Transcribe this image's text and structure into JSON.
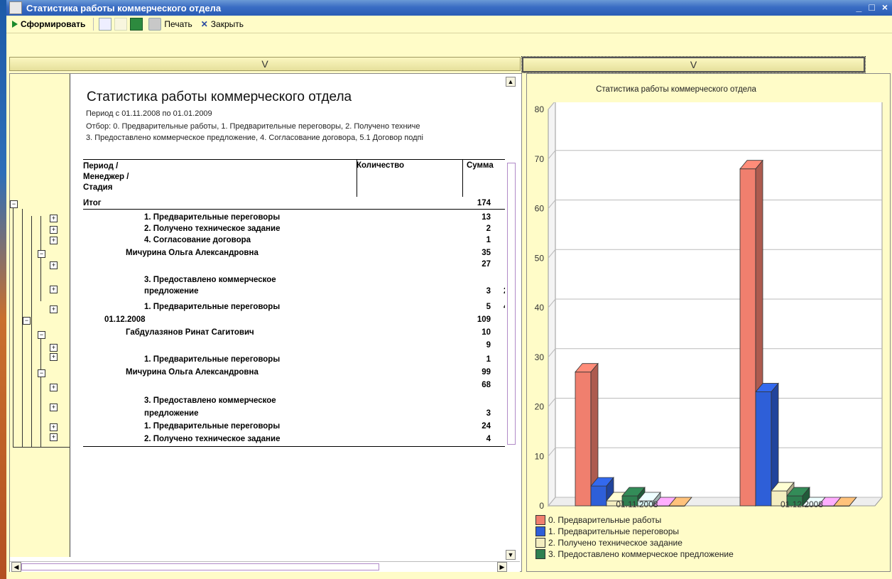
{
  "window": {
    "title": "Статистика работы коммерческого отдела",
    "controls": [
      "_",
      "□",
      "×"
    ]
  },
  "toolbar": {
    "generate_label": "Сформировать",
    "print_label": "Печать",
    "close_label": "Закрыть",
    "icons": [
      "play-icon",
      "expand-all-icon",
      "collapse-all-icon",
      "excel-icon",
      "printer-icon",
      "close-icon"
    ]
  },
  "splitter": {
    "left_glyph": "V",
    "right_glyph": "V"
  },
  "report": {
    "title": "Статистика работы коммерческого отдела",
    "period": "Период с 01.11.2008 по 01.01.2009",
    "filter_line1": "Отбор:  0. Предварительные работы, 1. Предварительные переговоры, 2. Получено техниче",
    "filter_line2": "3. Предоставлено коммерческое предложение, 4. Согласование договора, 5.1 Договор подпі",
    "header": {
      "period": "Период /",
      "manager": "Менеджер /",
      "stage": "Стадия",
      "qty": "Количество",
      "sum": "Сумма"
    },
    "rows": [
      {
        "label": "Итог",
        "value": "174",
        "sum": ""
      },
      {
        "label": "1. Предварительные переговоры",
        "value": "13",
        "sum": ""
      },
      {
        "label": "2. Получено техническое задание",
        "value": "2",
        "sum": ""
      },
      {
        "label": "4. Согласование договора",
        "value": "1",
        "sum": ""
      },
      {
        "label": "Мичурина Ольга Александровна",
        "value": "35",
        "sum": ""
      },
      {
        "label": "",
        "value": "27",
        "sum": ""
      },
      {
        "label": "3. Предоставлено коммерческое",
        "value": "",
        "sum": ""
      },
      {
        "label": "предложение",
        "value": "3",
        "sum": "2"
      },
      {
        "label": "1. Предварительные переговоры",
        "value": "5",
        "sum": "4"
      },
      {
        "label": "01.12.2008",
        "value": "109",
        "sum": ""
      },
      {
        "label": "Габдулазянов Ринат Сагитович",
        "value": "10",
        "sum": ""
      },
      {
        "label": "",
        "value": "9",
        "sum": ""
      },
      {
        "label": "1. Предварительные переговоры",
        "value": "1",
        "sum": ""
      },
      {
        "label": "Мичурина Ольга Александровна",
        "value": "99",
        "sum": ""
      },
      {
        "label": "",
        "value": "68",
        "sum": ""
      },
      {
        "label": "3. Предоставлено коммерческое",
        "value": "",
        "sum": ""
      },
      {
        "label": "предложение",
        "value": "3",
        "sum": ""
      },
      {
        "label": "1. Предварительные переговоры",
        "value": "24",
        "sum": ""
      },
      {
        "label": "2. Получено техническое задание",
        "value": "4",
        "sum": ""
      }
    ]
  },
  "chart_data": {
    "type": "bar",
    "title": "Статистика работы коммерческого отдела",
    "categories": [
      "01.11.2008",
      "01.12.2008"
    ],
    "ylim": [
      0,
      80
    ],
    "yticks": [
      0,
      10,
      20,
      30,
      40,
      50,
      60,
      70,
      80
    ],
    "grid": true,
    "three_d": true,
    "legend_position": "bottom",
    "series": [
      {
        "name": "0. Предварительные работы",
        "color": "#f07f6e",
        "values": [
          27,
          68
        ]
      },
      {
        "name": "1. Предварительные переговоры",
        "color": "#2e5fd8",
        "values": [
          4,
          23
        ]
      },
      {
        "name": "2. Получено техническое задание",
        "color": "#f4eec0",
        "values": [
          1,
          3
        ]
      },
      {
        "name": "3. Предоставлено коммерческое предложение",
        "color": "#2e7f50",
        "values": [
          2,
          2
        ]
      },
      {
        "name": "",
        "color": "#d8f4f4",
        "values": [
          1,
          0
        ]
      },
      {
        "name": "",
        "color": "#f09ef0",
        "values": [
          0,
          0
        ]
      },
      {
        "name": "",
        "color": "#f6b070",
        "values": [
          0,
          0
        ]
      }
    ]
  }
}
